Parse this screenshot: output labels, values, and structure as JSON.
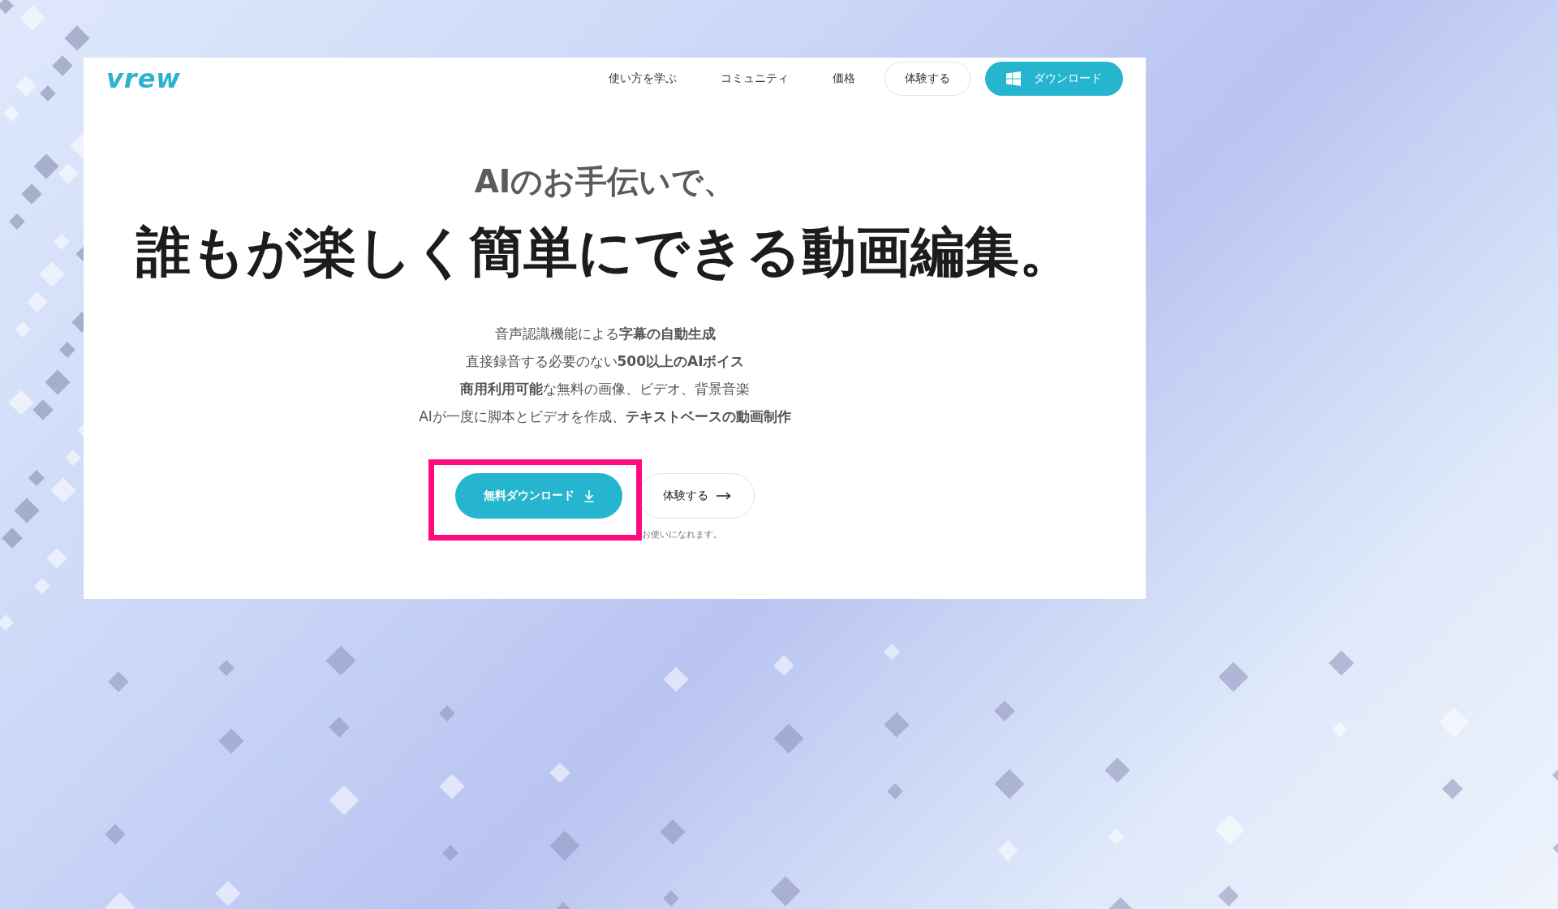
{
  "logo": "vrew",
  "nav": {
    "links": [
      "使い方を学ぶ",
      "コミュニティ",
      "価格"
    ],
    "trial_button": "体験する",
    "download_button": "ダウンロード"
  },
  "hero": {
    "subtitle": "AIのお手伝いで、",
    "title": "誰もが楽しく簡単にできる動画編集。",
    "features": [
      "音声認識機能による**字幕の自動生成**",
      "直接録音する必要のない**500以上のAIボイス**",
      "**商用利用可能**な無料の画像、ビデオ、背景音楽",
      "AIが一度に脚本とビデオを作成、**テキストベースの動画制作**"
    ]
  },
  "cta": {
    "download": "無料ダウンロード",
    "trial": "体験する",
    "note": "お使いになれます。"
  }
}
